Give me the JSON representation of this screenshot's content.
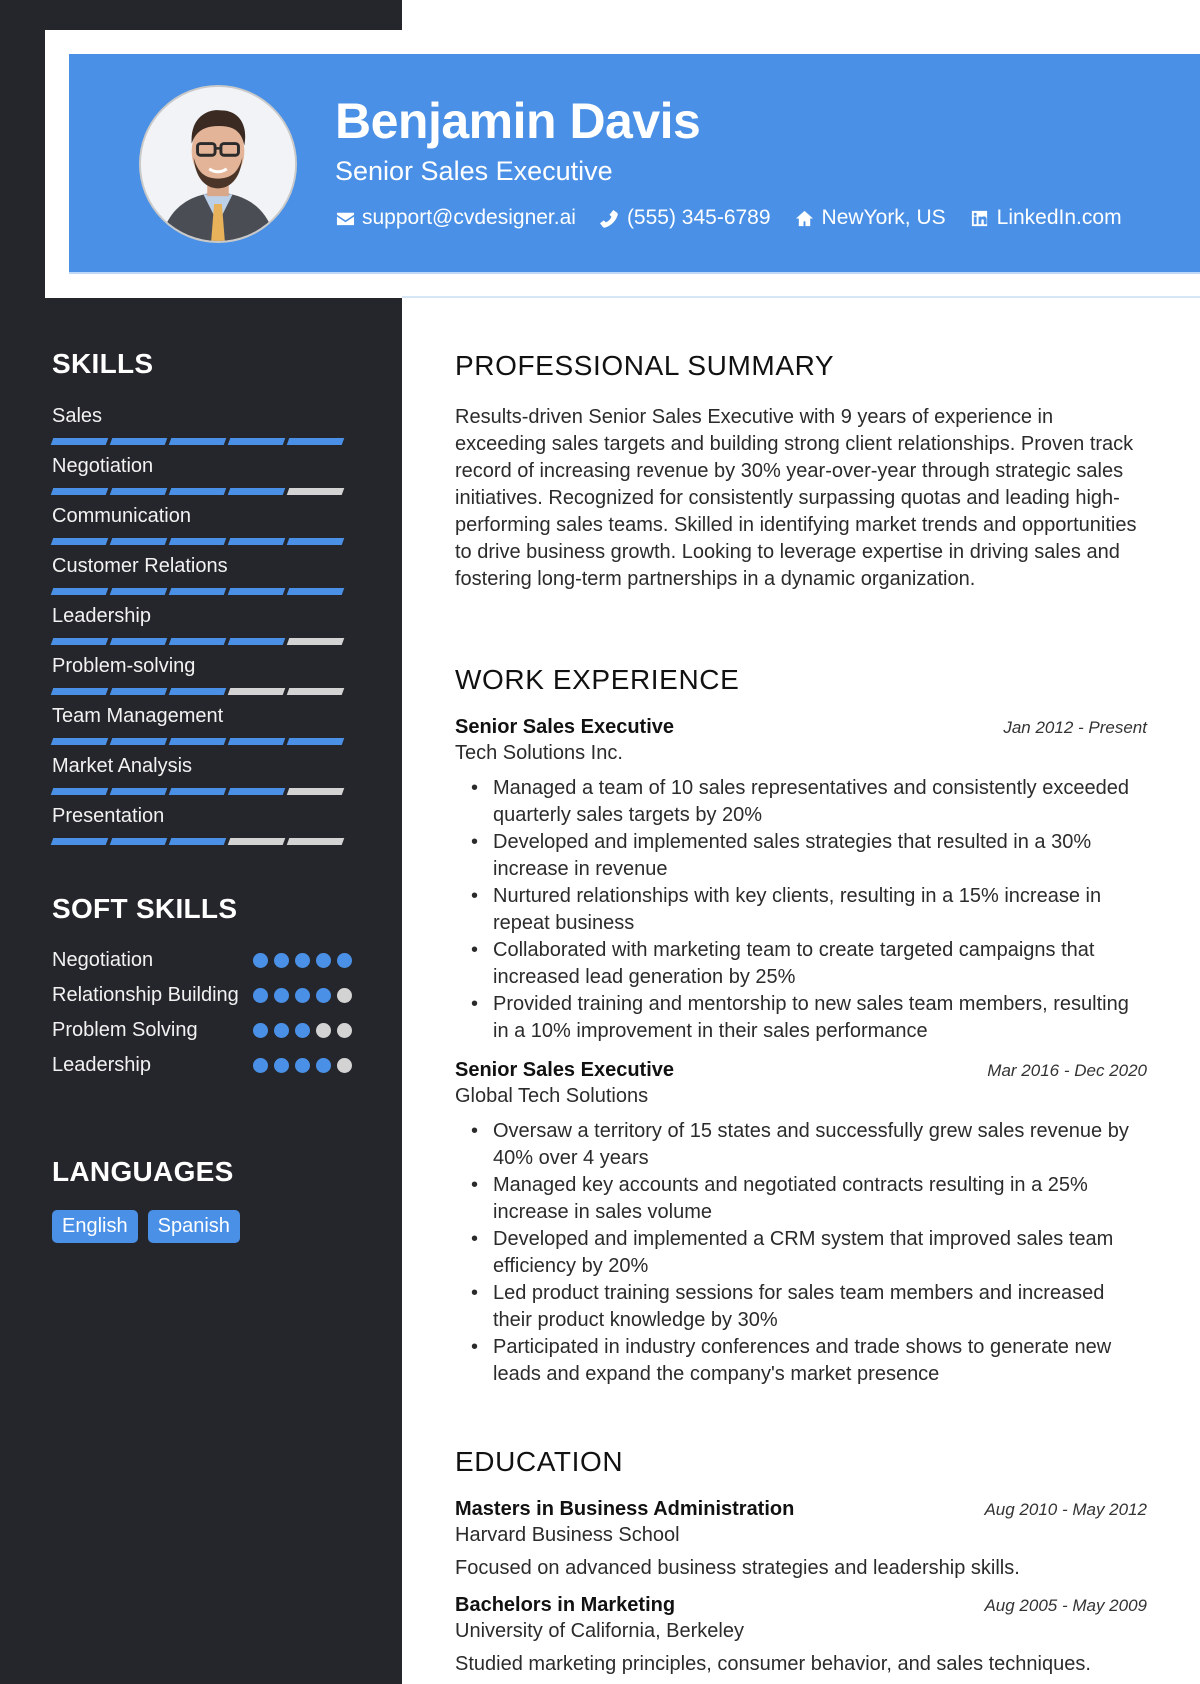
{
  "header": {
    "name": "Benjamin Davis",
    "title": "Senior Sales Executive",
    "contacts": [
      {
        "icon": "envelope-icon",
        "label": "support@cvdesigner.ai"
      },
      {
        "icon": "phone-icon",
        "label": "(555) 345-6789"
      },
      {
        "icon": "home-icon",
        "label": "NewYork, US"
      },
      {
        "icon": "linkedin-icon",
        "label": "LinkedIn.com"
      }
    ]
  },
  "colors": {
    "accent": "#4a90e6",
    "sidebar": "#25262b",
    "inactive": "#d3d3d3"
  },
  "sidebar": {
    "skills_heading": "SKILLS",
    "skills": [
      {
        "name": "Sales",
        "level": 5,
        "max": 5
      },
      {
        "name": "Negotiation",
        "level": 4,
        "max": 5
      },
      {
        "name": "Communication",
        "level": 5,
        "max": 5
      },
      {
        "name": "Customer Relations",
        "level": 5,
        "max": 5
      },
      {
        "name": "Leadership",
        "level": 4,
        "max": 5
      },
      {
        "name": "Problem-solving",
        "level": 3,
        "max": 5
      },
      {
        "name": "Team Management",
        "level": 5,
        "max": 5
      },
      {
        "name": "Market Analysis",
        "level": 4,
        "max": 5
      },
      {
        "name": "Presentation",
        "level": 3,
        "max": 5
      }
    ],
    "soft_skills_heading": "SOFT SKILLS",
    "soft_skills": [
      {
        "name": "Negotiation",
        "level": 5,
        "max": 5
      },
      {
        "name": "Relationship Building",
        "level": 4,
        "max": 5
      },
      {
        "name": "Problem Solving",
        "level": 3,
        "max": 5
      },
      {
        "name": "Leadership",
        "level": 4,
        "max": 5
      }
    ],
    "languages_heading": "LANGUAGES",
    "languages": [
      "English",
      "Spanish"
    ]
  },
  "main": {
    "summary_heading": "PROFESSIONAL SUMMARY",
    "summary": "Results-driven Senior Sales Executive with 9 years of experience in exceeding sales targets and building strong client relationships. Proven track record of increasing revenue by 30% year-over-year through strategic sales initiatives. Recognized for consistently surpassing quotas and leading high-performing sales teams. Skilled in identifying market trends and opportunities to drive business growth. Looking to leverage expertise in driving sales and fostering long-term partnerships in a dynamic organization.",
    "experience_heading": "WORK EXPERIENCE",
    "experience": [
      {
        "role": "Senior Sales Executive",
        "company": "Tech Solutions Inc.",
        "dates": "Jan 2012 - Present",
        "bullets": [
          "Managed a team of 10 sales representatives and consistently exceeded quarterly sales targets by 20%",
          "Developed and implemented sales strategies that resulted in a 30% increase in revenue",
          "Nurtured relationships with key clients, resulting in a 15% increase in repeat business",
          "Collaborated with marketing team to create targeted campaigns that increased lead generation by 25%",
          "Provided training and mentorship to new sales team members, resulting in a 10% improvement in their sales performance"
        ]
      },
      {
        "role": "Senior Sales Executive",
        "company": "Global Tech Solutions",
        "dates": "Mar 2016 - Dec 2020",
        "bullets": [
          "Oversaw a territory of 15 states and successfully grew sales revenue by 40% over 4 years",
          "Managed key accounts and negotiated contracts resulting in a 25% increase in sales volume",
          "Developed and implemented a CRM system that improved sales team efficiency by 20%",
          "Led product training sessions for sales team members and increased their product knowledge by 30%",
          "Participated in industry conferences and trade shows to generate new leads and expand the company's market presence"
        ]
      }
    ],
    "education_heading": "EDUCATION",
    "education": [
      {
        "degree": "Masters in Business Administration",
        "school": "Harvard Business School",
        "dates": "Aug 2010 - May 2012",
        "description": "Focused on advanced business strategies and leadership skills."
      },
      {
        "degree": "Bachelors in Marketing",
        "school": "University of California, Berkeley",
        "dates": "Aug 2005 - May 2009",
        "description": "Studied marketing principles, consumer behavior, and sales techniques."
      }
    ]
  }
}
